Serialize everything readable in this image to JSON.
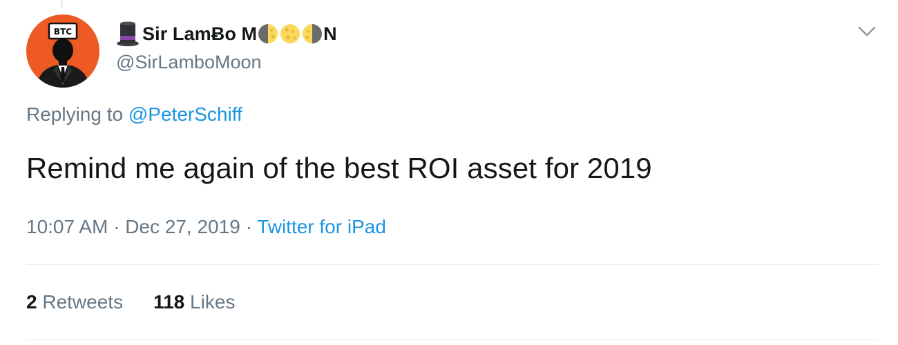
{
  "tweet": {
    "author": {
      "name_prefix": "Sir Lam",
      "name_b": "Ƀ",
      "name_mid": "o M",
      "name_suffix": "N",
      "handle": "@SirLamboMoon",
      "avatar_badge": "BTC"
    },
    "replying_label": "Replying to",
    "replying_mention": "@PeterSchiff",
    "text": "Remind me again of the best ROI asset for 2019",
    "time": "10:07 AM",
    "date": "Dec 27, 2019",
    "separator": "·",
    "source": "Twitter for iPad",
    "retweets_count": "2",
    "retweets_label": "Retweets",
    "likes_count": "118",
    "likes_label": "Likes"
  },
  "icons": {
    "hat": "top-hat-emoji",
    "moon": "first-quarter-moon-emoji",
    "moon2": "full-moon-emoji",
    "moon3": "last-quarter-moon-emoji",
    "menu": "chevron-down-icon"
  },
  "colors": {
    "link": "#1b95e0",
    "muted": "#657786",
    "text": "#14171a",
    "divider": "#e6ecf0",
    "avatar_bg": "#ee5a24"
  }
}
